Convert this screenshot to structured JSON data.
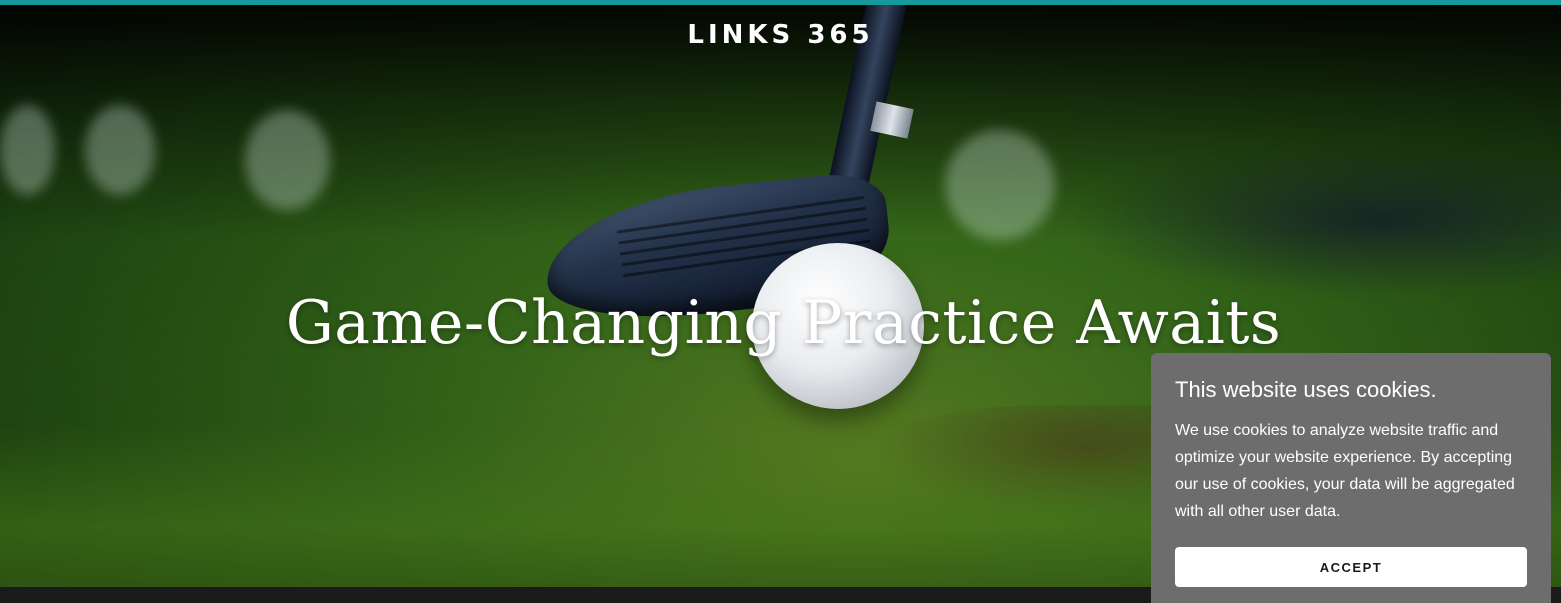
{
  "header": {
    "brand": "LINKS 365",
    "accent_color": "#16999a"
  },
  "hero": {
    "headline": "Game-Changing Practice Awaits"
  },
  "cookie_banner": {
    "title": "This website uses cookies.",
    "body": "We use cookies to analyze website traffic and optimize your website experience. By accepting our use of cookies, your data will be aggregated with all other user data.",
    "accept_label": "ACCEPT",
    "background_color": "#6d6d6d"
  }
}
